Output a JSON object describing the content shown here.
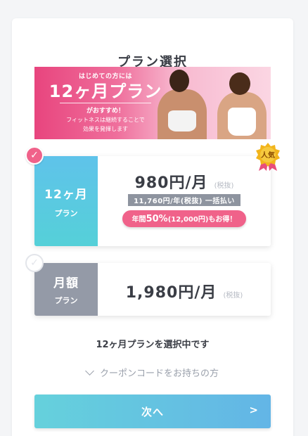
{
  "page": {
    "title": "プラン選択",
    "banner": {
      "line1": "はじめての方には",
      "plan": "12ヶ月プラン",
      "recommend": "がおすすめ！",
      "desc1": "フィットネスは継続することで",
      "desc2": "効果を発揮します"
    },
    "plans": [
      {
        "label_main": "12ヶ月",
        "label_sub": "プラン",
        "price": "980円/月",
        "tax": "(税抜)",
        "annual": "11,760円/年(税抜) 一括払い",
        "discount_pre": "年間",
        "discount_big": "50%",
        "discount_post": "(12,000円)もお得！",
        "badge": "人気",
        "selected": true
      },
      {
        "label_main": "月額",
        "label_sub": "プラン",
        "price": "1,980円/月",
        "tax": "(税抜)",
        "selected": false
      }
    ],
    "status": "12ヶ月プランを選択中です",
    "coupon": "クーポンコードをお持ちの方",
    "next_button": "次へ",
    "next_arrow": ">"
  },
  "colors": {
    "accent_pink": "#f0628a",
    "accent_blue": "#5fc3ea",
    "gray_plan": "#949aa7",
    "badge_gold": "#f2b51c"
  }
}
